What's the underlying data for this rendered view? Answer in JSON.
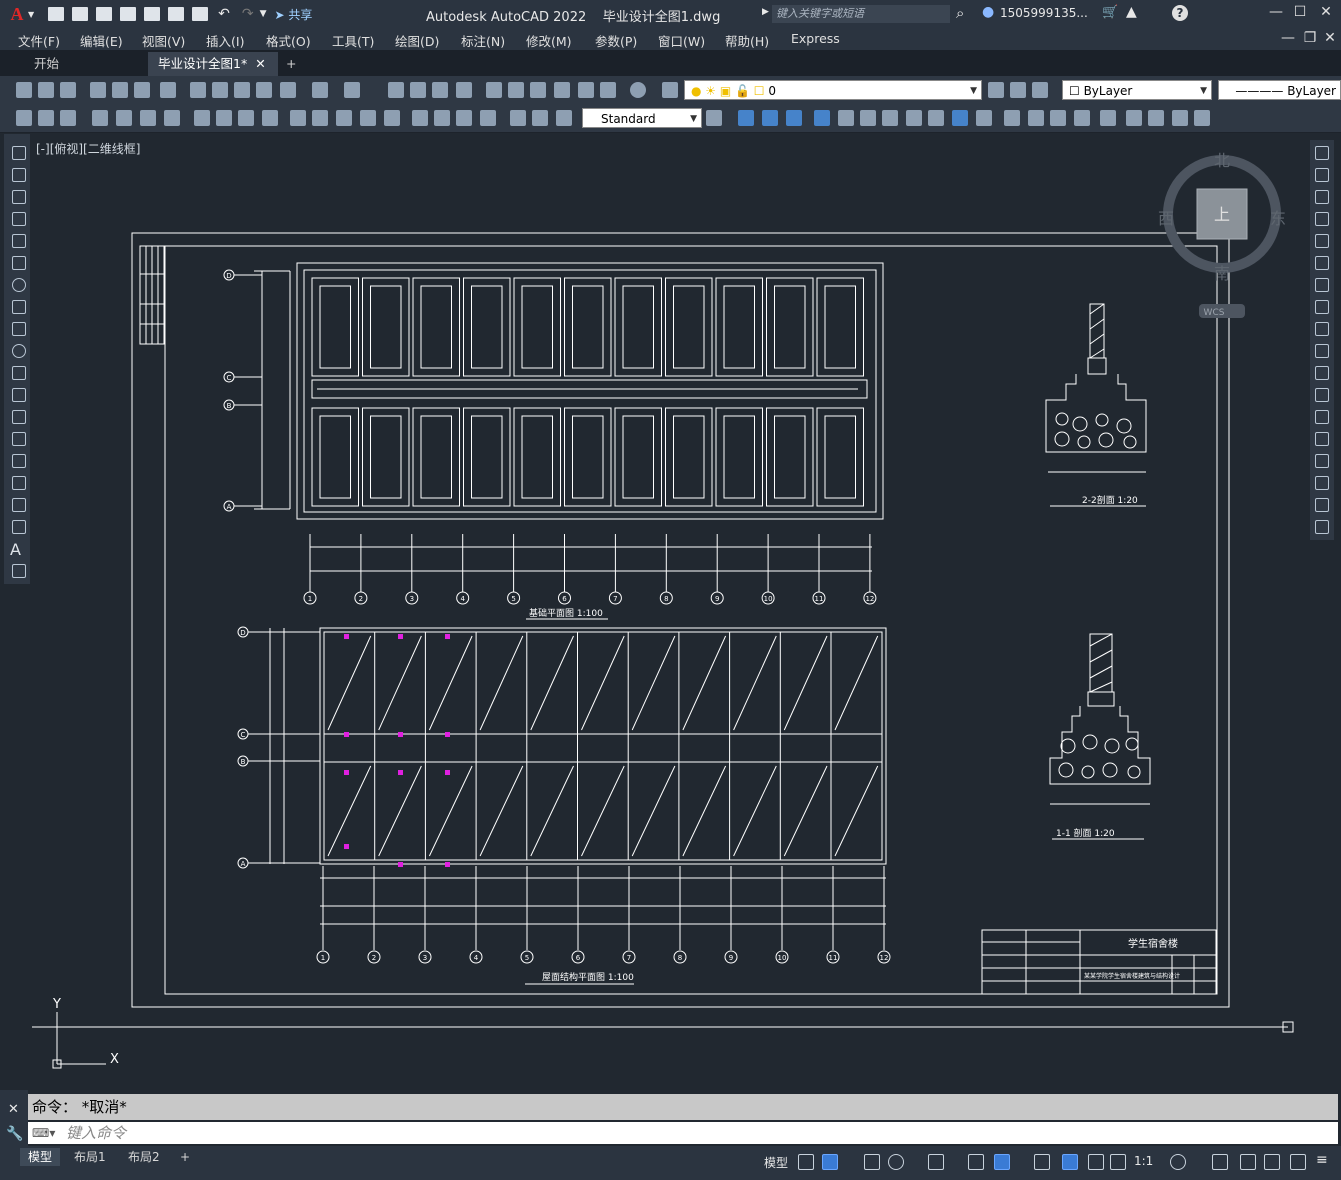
{
  "app": {
    "title": "Autodesk AutoCAD 2022",
    "filename": "毕业设计全图1.dwg",
    "search_placeholder": "键入关键字或短语",
    "user": "1505999135...",
    "share": "共享",
    "logo_letter": "A"
  },
  "menu": [
    "文件(F)",
    "编辑(E)",
    "视图(V)",
    "插入(I)",
    "格式(O)",
    "工具(T)",
    "绘图(D)",
    "标注(N)",
    "修改(M)",
    "参数(P)",
    "窗口(W)",
    "帮助(H)",
    "Express"
  ],
  "tabs": [
    {
      "label": "开始"
    },
    {
      "label": "毕业设计全图1*"
    }
  ],
  "toolbar": {
    "layer_value": "0",
    "color_value": "ByLayer",
    "linetype_value": "ByLayer",
    "text_style": "Standard"
  },
  "viewport": {
    "label": "[-][俯视][二维线框]",
    "viewcube": {
      "north": "北",
      "south": "南",
      "east": "东",
      "west": "西",
      "top": "上",
      "wcs": "WCS"
    },
    "ucs": {
      "x": "X",
      "y": "Y"
    }
  },
  "drawing": {
    "grid_top": [
      "D",
      "C",
      "B",
      "A"
    ],
    "grid_bottom": [
      "D",
      "C",
      "B",
      "A"
    ],
    "col_numbers": [
      "1",
      "2",
      "3",
      "4",
      "5",
      "6",
      "7",
      "8",
      "9",
      "10",
      "11",
      "12"
    ],
    "title_plan1": "基础平面图  1:100",
    "title_plan2": "屋面结构平面图  1:100",
    "section_22": "2-2剖面  1:20",
    "section_11": "1-1  剖面  1:20",
    "titleblock_name": "学生宿舍楼",
    "titleblock_sub": "某某学院学生宿舍楼建筑与结构设计"
  },
  "command": {
    "history": "命令：  *取消*",
    "input_placeholder": "键入命令"
  },
  "layouts": [
    {
      "label": "模型"
    },
    {
      "label": "布局1"
    },
    {
      "label": "布局2"
    }
  ],
  "status": {
    "model": "模型",
    "scale": "1:1"
  }
}
